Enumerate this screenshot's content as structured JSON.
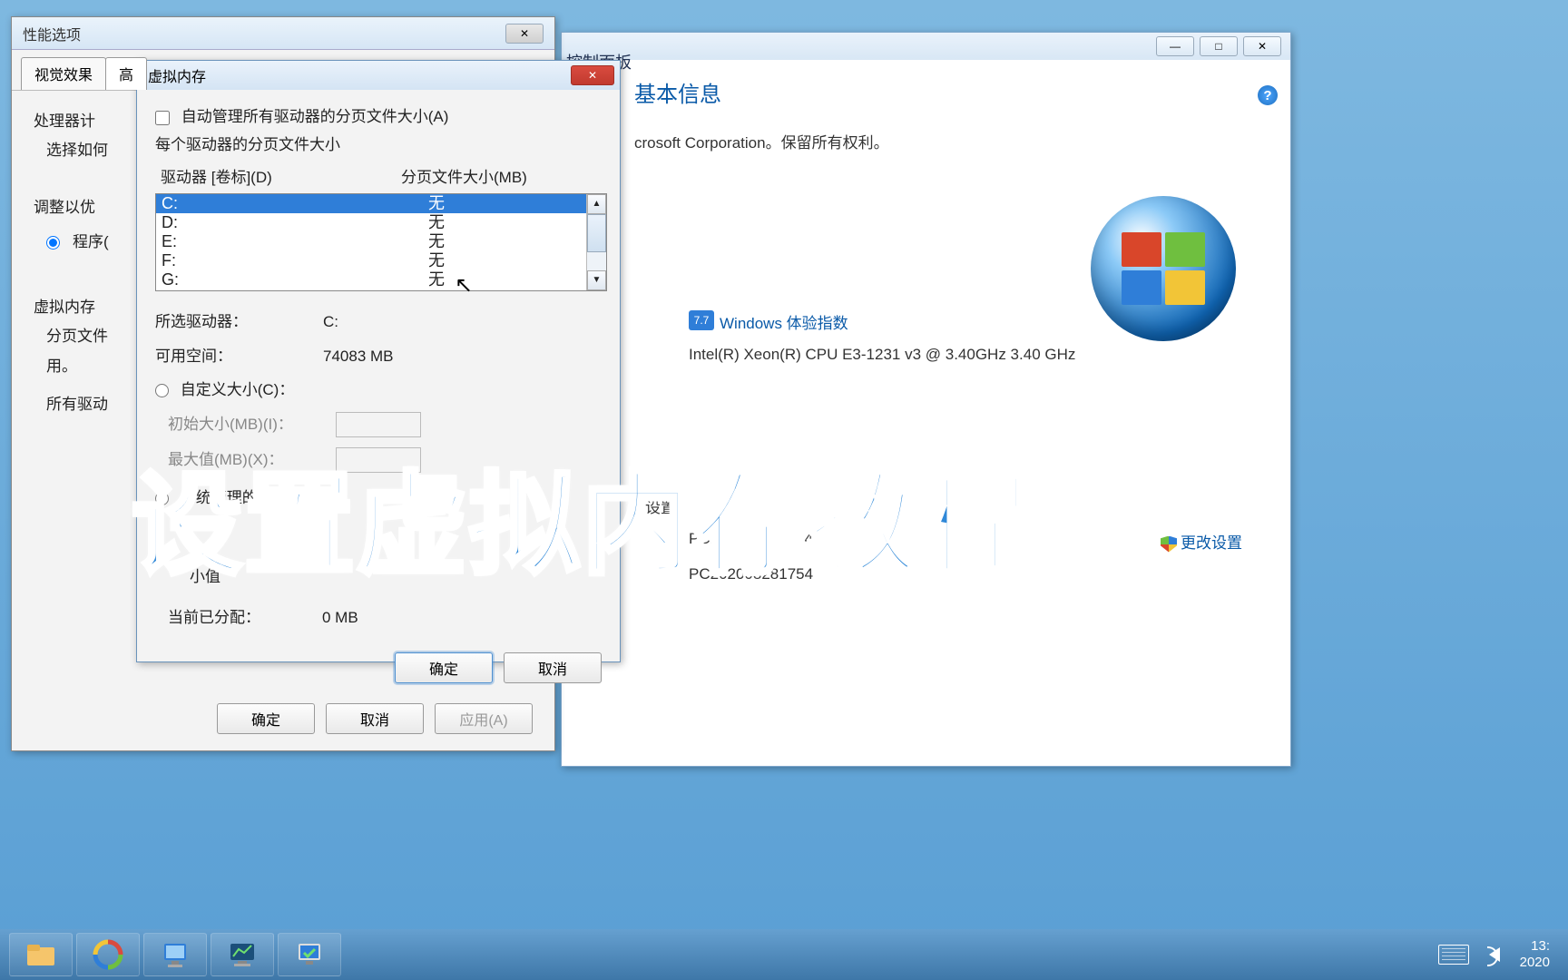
{
  "bg_window": {
    "peek_title": "控制面板",
    "controls": {
      "min": "—",
      "max": "□",
      "close": "✕"
    },
    "heading_suffix": "基本信息",
    "copyright_suffix": "crosoft Corporation。保留所有权利。",
    "wei_badge": "7.7",
    "wei_link": "Windows 体验指数",
    "cpu": "Intel(R) Xeon(R) CPU E3-1231 v3 @ 3.40GHz   3.40 GHz",
    "settings_label": "设置",
    "computer_name_1": "PC202008281754",
    "computer_name_2": "PC202008281754",
    "change_settings": "更改设置"
  },
  "perf_window": {
    "title": "性能选项",
    "tabs": [
      "视觉效果",
      "高"
    ],
    "body": {
      "l1": "处理器计",
      "l2": "选择如何",
      "l3": "调整以优",
      "radio_program": "程序(",
      "vm_heading": "虚拟内存",
      "vm_desc1": "分页文件",
      "vm_desc2": "用。",
      "vm_all": "所有驱动"
    },
    "buttons": {
      "ok": "确定",
      "cancel": "取消",
      "apply": "应用(A)"
    }
  },
  "vm_dialog": {
    "title": "虚拟内存",
    "auto_manage": "自动管理所有驱动器的分页文件大小(A)",
    "each_drive": "每个驱动器的分页文件大小",
    "col_drive": "驱动器 [卷标](D)",
    "col_page": "分页文件大小(MB)",
    "drives": [
      {
        "d": "C:",
        "p": "无",
        "sel": true
      },
      {
        "d": "D:",
        "p": "无",
        "sel": false
      },
      {
        "d": "E:",
        "p": "无",
        "sel": false
      },
      {
        "d": "F:",
        "p": "无",
        "sel": false
      },
      {
        "d": "G:",
        "p": "无",
        "sel": false
      }
    ],
    "selected_drive_label": "所选驱动器：",
    "selected_drive": "C:",
    "free_space_label": "可用空间：",
    "free_space": "74083 MB",
    "custom_size": "自定义大小(C)：",
    "init_size": "初始大小(MB)(I)：",
    "max_size": "最大值(MB)(X)：",
    "system_managed": "系统管理的大小(Y)",
    "min_label": "小值",
    "allocated_label": "当前已分配：",
    "allocated": "0 MB",
    "ok": "确定",
    "cancel": "取消"
  },
  "overlay": "设置虚拟内存教程",
  "taskbar": {
    "clock_time": "13:",
    "clock_date": "2020"
  }
}
